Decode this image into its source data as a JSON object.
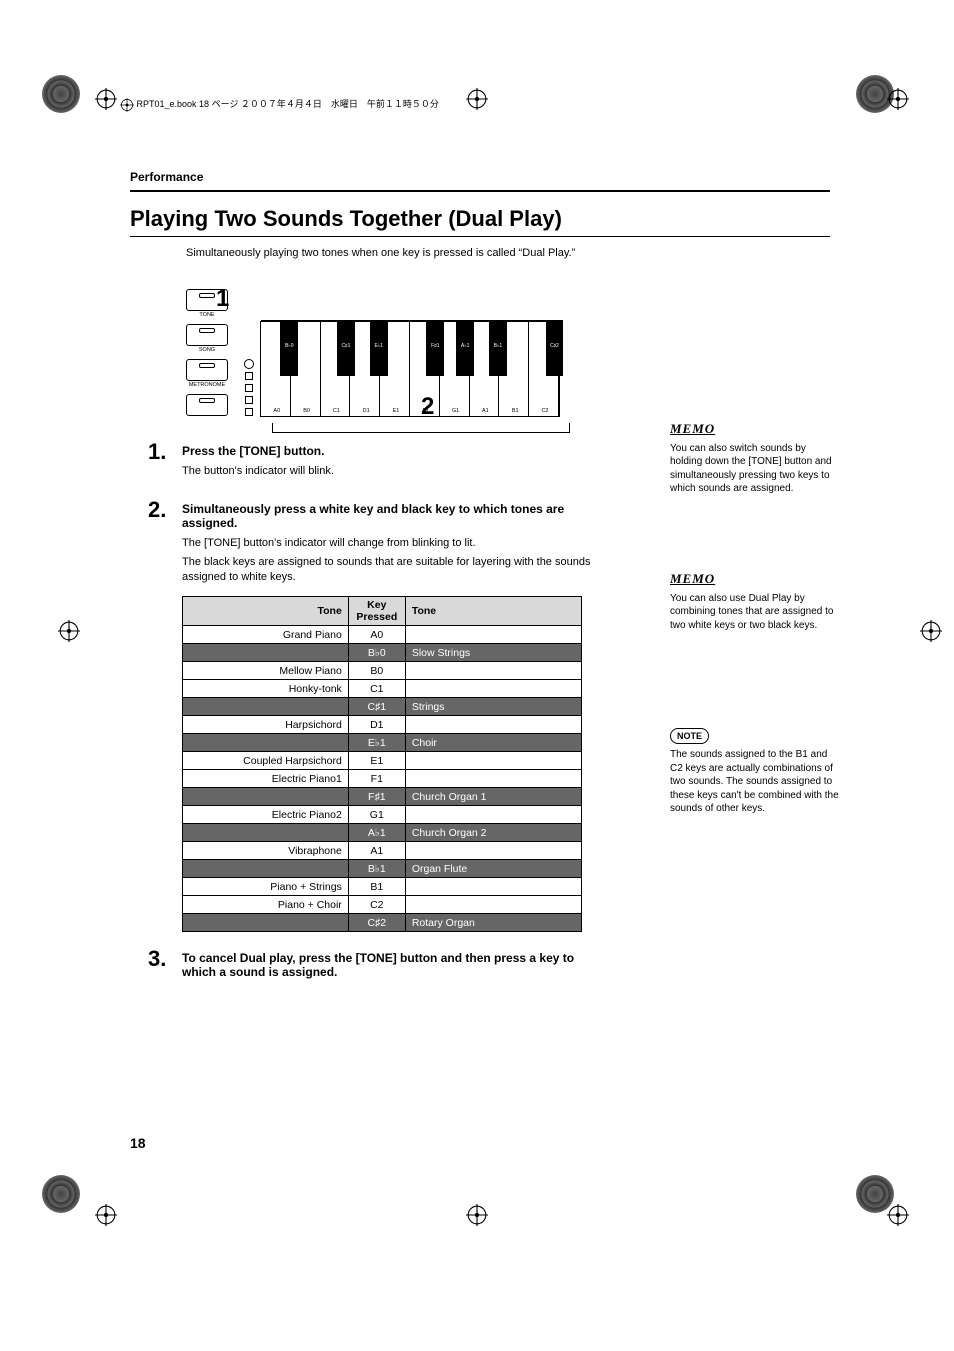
{
  "meta": {
    "header_line": "RPT01_e.book  18 ページ  ２００７年４月４日　水曜日　午前１１時５０分"
  },
  "section": "Performance",
  "title": "Playing Two Sounds Together (Dual Play)",
  "intro": "Simultaneously playing two tones when one key is pressed is called “Dual Play.”",
  "figure": {
    "callout1": "1",
    "callout2": "2",
    "buttons": [
      {
        "label": "TONE"
      },
      {
        "label": "SONG"
      },
      {
        "label": "METRONOME"
      },
      {
        "label": ""
      }
    ],
    "white_keys": [
      "A0",
      "B0",
      "C1",
      "D1",
      "E1",
      "F1",
      "G1",
      "A1",
      "B1",
      "C2"
    ],
    "black_keys": [
      "B♭0",
      "C♯1",
      "E♭1",
      "F♯1",
      "A♭1",
      "B♭1",
      "C♯2"
    ]
  },
  "steps": [
    {
      "num": "1.",
      "title": "Press the [TONE] button.",
      "paras": [
        "The button's indicator will blink."
      ]
    },
    {
      "num": "2.",
      "title": "Simultaneously press a white key and black key to which tones are assigned.",
      "paras": [
        "The [TONE] button's indicator will change from blinking to lit.",
        "The black keys are assigned to sounds that are suitable for layering with the sounds assigned to white keys."
      ]
    },
    {
      "num": "3.",
      "title": "To cancel Dual play, press the [TONE] button and then press a key to which a sound is assigned.",
      "paras": []
    }
  ],
  "table": {
    "headers": {
      "left": "Tone",
      "key": "Key Pressed",
      "right": "Tone"
    },
    "rows": [
      {
        "left": "Grand Piano",
        "key": "A0",
        "right": "",
        "black": false
      },
      {
        "left": "",
        "key": "B♭0",
        "right": "Slow Strings",
        "black": true
      },
      {
        "left": "Mellow Piano",
        "key": "B0",
        "right": "",
        "black": false
      },
      {
        "left": "Honky-tonk",
        "key": "C1",
        "right": "",
        "black": false
      },
      {
        "left": "",
        "key": "C♯1",
        "right": "Strings",
        "black": true
      },
      {
        "left": "Harpsichord",
        "key": "D1",
        "right": "",
        "black": false
      },
      {
        "left": "",
        "key": "E♭1",
        "right": "Choir",
        "black": true
      },
      {
        "left": "Coupled Harpsichord",
        "key": "E1",
        "right": "",
        "black": false
      },
      {
        "left": "Electric Piano1",
        "key": "F1",
        "right": "",
        "black": false
      },
      {
        "left": "",
        "key": "F♯1",
        "right": "Church Organ 1",
        "black": true
      },
      {
        "left": "Electric Piano2",
        "key": "G1",
        "right": "",
        "black": false
      },
      {
        "left": "",
        "key": "A♭1",
        "right": "Church Organ 2",
        "black": true
      },
      {
        "left": "Vibraphone",
        "key": "A1",
        "right": "",
        "black": false
      },
      {
        "left": "",
        "key": "B♭1",
        "right": "Organ Flute",
        "black": true
      },
      {
        "left": "Piano + Strings",
        "key": "B1",
        "right": "",
        "black": false
      },
      {
        "left": "Piano + Choir",
        "key": "C2",
        "right": "",
        "black": false
      },
      {
        "left": "",
        "key": "C♯2",
        "right": "Rotary Organ",
        "black": true
      }
    ]
  },
  "sidebar": {
    "memo1": {
      "label": "MEMO",
      "text": "You can also switch sounds by holding down the [TONE] button and simultaneously pressing two keys to which sounds are assigned."
    },
    "memo2": {
      "label": "MEMO",
      "text": "You can also use Dual Play by combining tones that are assigned to two white keys or two black keys."
    },
    "note": {
      "label": "NOTE",
      "text": "The sounds assigned to the B1 and C2 keys are actually combinations of two sounds. The sounds assigned to these keys can't be combined with the sounds of other keys."
    }
  },
  "page_number": "18"
}
